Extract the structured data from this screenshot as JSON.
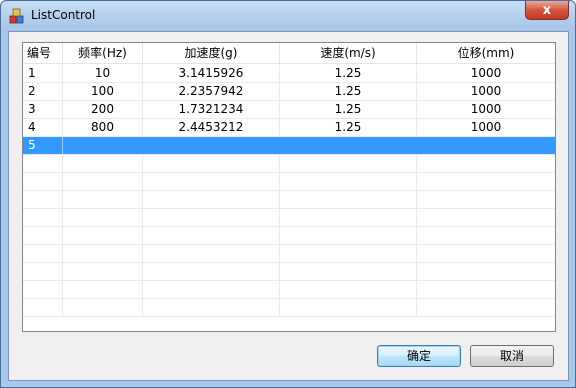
{
  "window": {
    "title": "ListControl",
    "close_symbol": "x"
  },
  "colors": {
    "selection": "#3399ff",
    "frame": "#a9c9ec",
    "client_bg": "#f0f0f0",
    "close_button": "#c8412b"
  },
  "icons": {
    "app": "app-icon",
    "close": "close-icon"
  },
  "list": {
    "columns": [
      "编号",
      "频率(Hz)",
      "加速度(g)",
      "速度(m/s)",
      "位移(mm)"
    ],
    "rows": [
      [
        "1",
        "10",
        "3.1415926",
        "1.25",
        "1000"
      ],
      [
        "2",
        "100",
        "2.2357942",
        "1.25",
        "1000"
      ],
      [
        "3",
        "200",
        "1.7321234",
        "1.25",
        "1000"
      ],
      [
        "4",
        "800",
        "2.4453212",
        "1.25",
        "1000"
      ],
      [
        "5",
        "",
        "",
        "",
        ""
      ]
    ],
    "selected_row": 4,
    "empty_row_count": 9
  },
  "buttons": {
    "ok": "确定",
    "cancel": "取消"
  }
}
